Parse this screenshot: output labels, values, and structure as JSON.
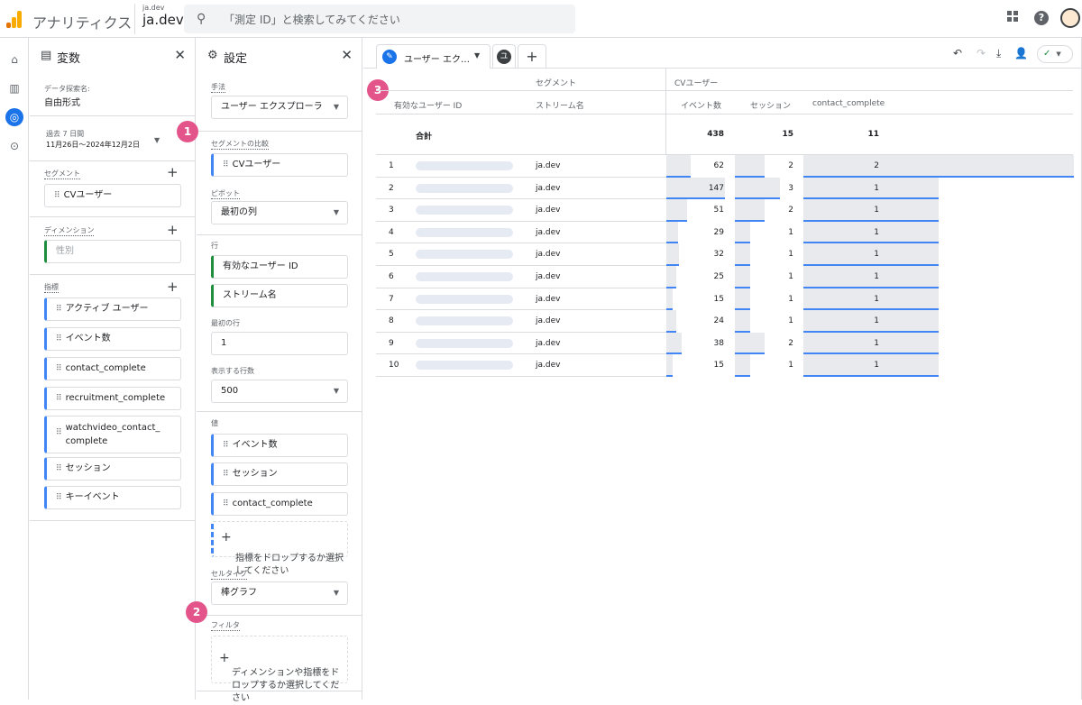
{
  "app": {
    "name": "アナリティクス",
    "account_small": "ja.dev",
    "account_large": "ja.dev",
    "search_placeholder": "「測定 ID」と検索してみてください"
  },
  "variables_panel": {
    "title": "変数",
    "exploration_name_label": "データ探索名:",
    "exploration_name": "自由形式",
    "date_range_label": "過去 7 日間",
    "date_range_value": "11月26日〜2024年12月2日",
    "segments_label": "セグメント",
    "segments": [
      "CVユーザー"
    ],
    "dimensions_label": "ディメンション",
    "dimensions": [
      "性別"
    ],
    "metrics_label": "指標",
    "metrics": [
      "アクティブ ユーザー",
      "イベント数",
      "contact_complete",
      "recruitment_complete",
      "watchvideo_contact_\ncomplete",
      "セッション",
      "キーイベント"
    ]
  },
  "settings_panel": {
    "title": "設定",
    "technique_label": "手法",
    "technique": "ユーザー エクスプローラ",
    "segment_compare_label": "セグメントの比較",
    "segment_compare": "CVユーザー",
    "pivot_label": "ピボット",
    "pivot": "最初の列",
    "rows_label": "行",
    "rows": [
      "有効なユーザー ID",
      "ストリーム名"
    ],
    "first_row_label": "最初の行",
    "first_row": "1",
    "rows_shown_label": "表示する行数",
    "rows_shown": "500",
    "values_label": "値",
    "values": [
      "イベント数",
      "セッション",
      "contact_complete"
    ],
    "values_drop": "指標をドロップするか選択\nしてください",
    "cell_type_label": "セルタイプ",
    "cell_type": "棒グラフ",
    "filter_label": "フィルタ",
    "filter_drop": "ディメンションや指標をド\nロップするか選択してくだ\nさい"
  },
  "badges": [
    "1",
    "2",
    "3"
  ],
  "tabs": {
    "active": "ユーザー エク…",
    "second": "ユ",
    "add": "+"
  },
  "table": {
    "segment_header": "セグメント",
    "segment_value": "CVユーザー",
    "col_user_id": "有効なユーザー ID",
    "col_stream": "ストリーム名",
    "col_events": "イベント数",
    "col_sessions": "セッション",
    "col_contact": "contact_complete",
    "total_label": "合計",
    "total_events": "438",
    "total_sessions": "15",
    "total_contact": "11",
    "rows": [
      {
        "n": "1",
        "stream": "ja.dev",
        "events": 62,
        "sessions": 2,
        "contact": 2
      },
      {
        "n": "2",
        "stream": "ja.dev",
        "events": 147,
        "sessions": 3,
        "contact": 1
      },
      {
        "n": "3",
        "stream": "ja.dev",
        "events": 51,
        "sessions": 2,
        "contact": 1
      },
      {
        "n": "4",
        "stream": "ja.dev",
        "events": 29,
        "sessions": 1,
        "contact": 1
      },
      {
        "n": "5",
        "stream": "ja.dev",
        "events": 32,
        "sessions": 1,
        "contact": 1
      },
      {
        "n": "6",
        "stream": "ja.dev",
        "events": 25,
        "sessions": 1,
        "contact": 1
      },
      {
        "n": "7",
        "stream": "ja.dev",
        "events": 15,
        "sessions": 1,
        "contact": 1
      },
      {
        "n": "8",
        "stream": "ja.dev",
        "events": 24,
        "sessions": 1,
        "contact": 1
      },
      {
        "n": "9",
        "stream": "ja.dev",
        "events": 38,
        "sessions": 2,
        "contact": 1
      },
      {
        "n": "10",
        "stream": "ja.dev",
        "events": 15,
        "sessions": 1,
        "contact": 1
      }
    ]
  },
  "icons": {
    "search": "search-icon",
    "apps": "apps-grid-icon",
    "help": "help-icon",
    "avatar": "avatar-icon"
  },
  "colors": {
    "accent": "#1a73e8",
    "badge": "#e3558a",
    "bar_line": "#4285f4"
  }
}
